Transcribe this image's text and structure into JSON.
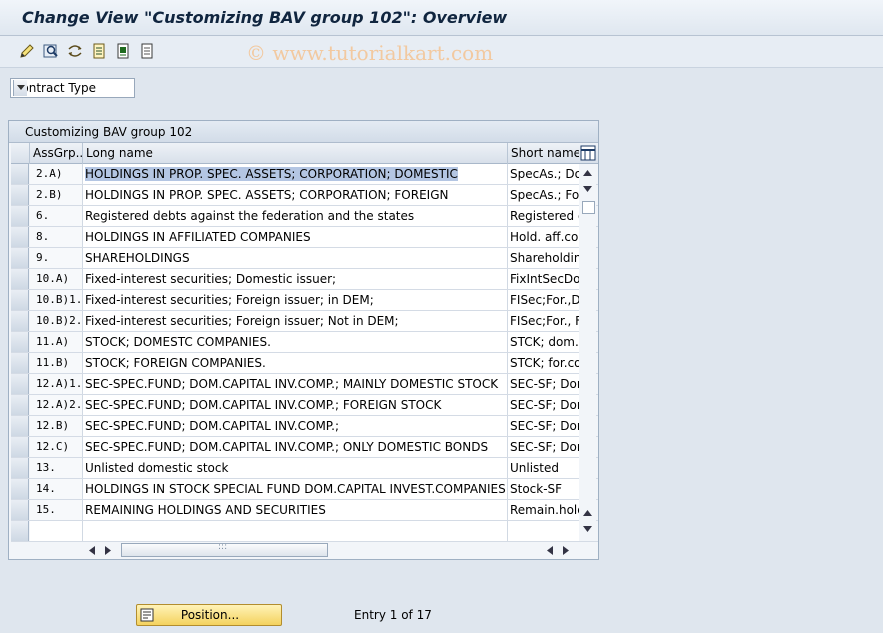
{
  "window": {
    "title": "Change View \"Customizing BAV group 102\": Overview"
  },
  "watermark": "© www.tutorialkart.com",
  "toolbar": {
    "icons": [
      "edit-pencil-icon",
      "find-icon",
      "undo-change-icon",
      "document-icon",
      "select-all-icon",
      "deselect-icon"
    ]
  },
  "contract_type": {
    "label": "Contract Type"
  },
  "panel": {
    "title": "Customizing BAV group 102",
    "columns": {
      "assgrp": "AssGrp...",
      "long_name": "Long name",
      "short_name": "Short name"
    },
    "rows": [
      {
        "grp": "2.A)",
        "long": "HOLDINGS IN PROP. SPEC. ASSETS; CORPORATION; DOMESTIC",
        "short": "SpecAs.; Dom"
      },
      {
        "grp": "2.B)",
        "long": "HOLDINGS IN PROP. SPEC. ASSETS; CORPORATION; FOREIGN",
        "short": "SpecAs.; For"
      },
      {
        "grp": "6.",
        "long": "Registered debts against the federation and the states",
        "short": "Registered d"
      },
      {
        "grp": "8.",
        "long": "HOLDINGS IN AFFILIATED COMPANIES",
        "short": "Hold. aff.con"
      },
      {
        "grp": "9.",
        "long": "SHAREHOLDINGS",
        "short": "Shareholding"
      },
      {
        "grp": "10.A)",
        "long": "Fixed-interest securities; Domestic issuer;",
        "short": "FixIntSecDor"
      },
      {
        "grp": "10.B)1.",
        "long": "Fixed-interest securities; Foreign issuer; in DEM;",
        "short": "FISec;For.,DI"
      },
      {
        "grp": "10.B)2.",
        "long": "Fixed-interest securities; Foreign issuer; Not in DEM;",
        "short": "FISec;For., F"
      },
      {
        "grp": "11.A)",
        "long": "STOCK; DOMESTC COMPANIES.",
        "short": "STCK; dom.c"
      },
      {
        "grp": "11.B)",
        "long": "STOCK; FOREIGN COMPANIES.",
        "short": "STCK; for.co"
      },
      {
        "grp": "12.A)1.",
        "long": "SEC-SPEC.FUND; DOM.CAPITAL INV.COMP.; MAINLY DOMESTIC STOCK",
        "short": "SEC-SF; Dom"
      },
      {
        "grp": "12.A)2.",
        "long": "SEC-SPEC.FUND; DOM.CAPITAL INV.COMP.; FOREIGN STOCK",
        "short": "SEC-SF; Dom"
      },
      {
        "grp": "12.B)",
        "long": "SEC-SPEC.FUND; DOM.CAPITAL INV.COMP.;",
        "short": "SEC-SF; Dom"
      },
      {
        "grp": "12.C)",
        "long": "SEC-SPEC.FUND; DOM.CAPITAL INV.COMP.; ONLY DOMESTIC BONDS",
        "short": "SEC-SF; Dom"
      },
      {
        "grp": "13.",
        "long": "Unlisted domestic stock",
        "short": "Unlisted"
      },
      {
        "grp": "14.",
        "long": "HOLDINGS IN STOCK SPECIAL FUND DOM.CAPITAL INVEST.COMPANIES",
        "short": "Stock-SF"
      },
      {
        "grp": "15.",
        "long": "REMAINING HOLDINGS AND SECURITIES",
        "short": "Remain.holdi"
      }
    ]
  },
  "footer": {
    "position_label": "Position...",
    "entry_text": "Entry 1 of 17"
  },
  "colors": {
    "selection": "#b4c6e3",
    "button": "#f4d25e",
    "background": "#dfe6ee"
  }
}
